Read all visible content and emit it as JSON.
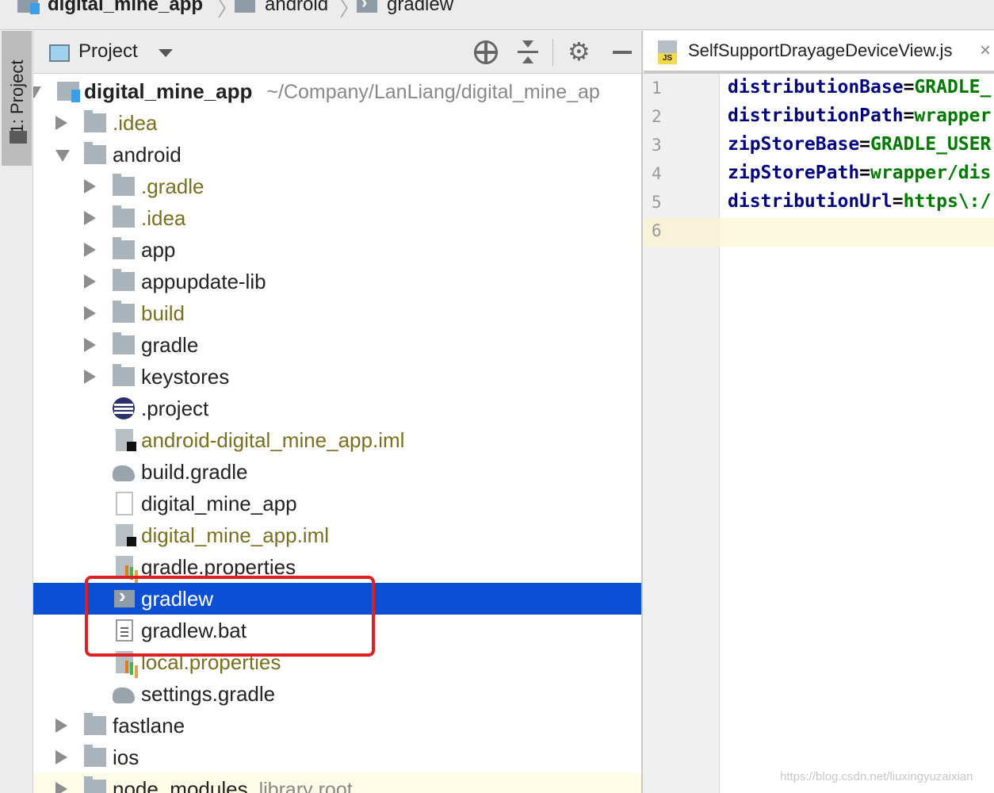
{
  "breadcrumb": {
    "items": [
      "digital_mine_app",
      "android",
      "gradlew"
    ]
  },
  "tool_window": {
    "tab_label": "1: Project"
  },
  "project_panel": {
    "title": "Project",
    "root": {
      "name": "digital_mine_app",
      "path": "~/Company/LanLiang/digital_mine_ap"
    },
    "tree": [
      {
        "label": ".idea"
      },
      {
        "label": "android"
      },
      {
        "label": ".gradle"
      },
      {
        "label": ".idea"
      },
      {
        "label": "app"
      },
      {
        "label": "appupdate-lib"
      },
      {
        "label": "build"
      },
      {
        "label": "gradle"
      },
      {
        "label": "keystores"
      },
      {
        "label": ".project"
      },
      {
        "label": "android-digital_mine_app.iml"
      },
      {
        "label": "build.gradle"
      },
      {
        "label": "digital_mine_app"
      },
      {
        "label": "digital_mine_app.iml"
      },
      {
        "label": "gradle.properties"
      },
      {
        "label": "gradlew"
      },
      {
        "label": "gradlew.bat"
      },
      {
        "label": "local.properties"
      },
      {
        "label": "settings.gradle"
      },
      {
        "label": "fastlane"
      },
      {
        "label": "ios"
      },
      {
        "label": "node_modules",
        "suffix": "library root"
      }
    ],
    "colors": {
      "selected_bg": "#0b50d4",
      "excluded_text": "#7a6f1e",
      "highlight_box": "#e02020"
    }
  },
  "editor": {
    "tab_name": "SelfSupportDrayageDeviceView.js",
    "tab_badge": "JS",
    "line_numbers": [
      "1",
      "2",
      "3",
      "4",
      "5",
      "6"
    ],
    "lines": [
      {
        "key": "distributionBase",
        "value": "GRADLE_"
      },
      {
        "key": "distributionPath",
        "value": "wrapper"
      },
      {
        "key": "zipStoreBase",
        "value": "GRADLE_USER"
      },
      {
        "key": "zipStorePath",
        "value": "wrapper/dis"
      },
      {
        "key": "distributionUrl",
        "value": "https\\:/"
      }
    ],
    "eq": "="
  },
  "watermark": "https://blog.csdn.net/liuxingyuzaixian"
}
